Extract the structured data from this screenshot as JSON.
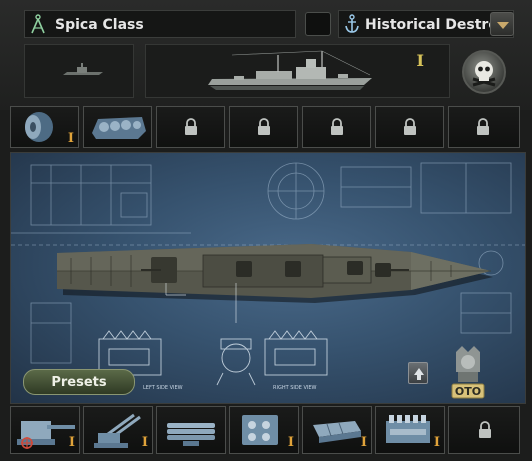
{
  "header": {
    "ship_name": "Spica Class",
    "role": "Historical Destro...",
    "hull_tier": "I"
  },
  "module_row": {
    "slots": [
      {
        "icon": "fuel-tank-icon",
        "tier": "I",
        "locked": false
      },
      {
        "icon": "engine-block-icon",
        "tier": "",
        "locked": false
      },
      {
        "icon": "lock-icon",
        "locked": true
      },
      {
        "icon": "lock-icon",
        "locked": true
      },
      {
        "icon": "lock-icon",
        "locked": true
      },
      {
        "icon": "lock-icon",
        "locked": true
      },
      {
        "icon": "lock-icon",
        "locked": true
      }
    ]
  },
  "blueprint": {
    "left_label": "LEFT SIDE VIEW",
    "right_label": "RIGHT SIDE VIEW"
  },
  "buttons": {
    "presets": "Presets"
  },
  "equipment_row": {
    "slots": [
      {
        "icon": "naval-gun-icon",
        "tier": "I"
      },
      {
        "icon": "aa-gun-icon",
        "tier": "I"
      },
      {
        "icon": "torpedo-tubes-icon",
        "tier": ""
      },
      {
        "icon": "fire-control-icon",
        "tier": "I"
      },
      {
        "icon": "armor-plate-icon",
        "tier": "I"
      },
      {
        "icon": "engine-icon",
        "tier": "I"
      },
      {
        "icon": "lock-icon",
        "tier": ""
      }
    ]
  },
  "manufacturer": {
    "name": "OTO"
  },
  "colors": {
    "tier_gold": "#d6c25a",
    "tier_orange": "#e0a33a",
    "blueprint_blue": "#36526e"
  }
}
